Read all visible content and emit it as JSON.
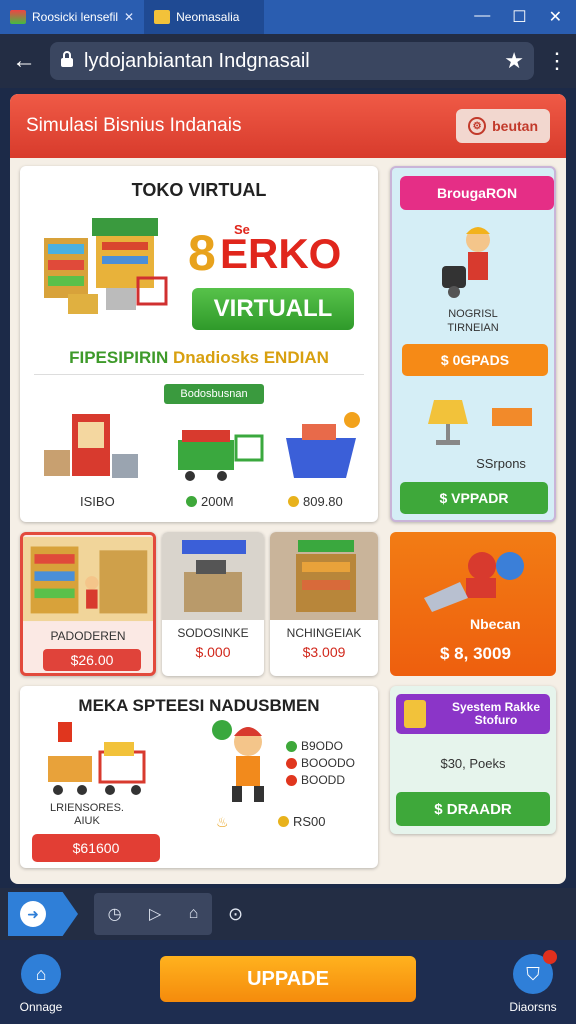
{
  "browser": {
    "tab1_title": "Roosicki lensefil",
    "tab2_title": "Neomasalia",
    "url": "lydojanbiantan Indgnasail"
  },
  "app": {
    "header_title": "Simulasi Bisnius Indanais",
    "header_button": "beutan"
  },
  "main_card": {
    "title": "TOKO VIRTUAL",
    "brand_digit": "8",
    "brand_small": "Se",
    "brand_text": "ERKO",
    "virtual_button": "VIRTUALL",
    "subtitle_green": "FIPESIPIRIN",
    "subtitle_yellow": "Dnadiosks ENDIAN",
    "tag": "Bodosbusnan",
    "products": [
      {
        "label": "ISIBO"
      },
      {
        "label": "200M"
      },
      {
        "label": "809.80"
      }
    ]
  },
  "side_card_1": {
    "header": "BrougaRON",
    "text_line1": "NOGRISL",
    "text_line2": "TIRNEIAN",
    "orange_button": "$ 0GPADS",
    "subtext": "SSrpons",
    "green_button": "$ VPPADR"
  },
  "tiles": [
    {
      "label": "PADODEREN",
      "price": "$26.00"
    },
    {
      "label": "SODOSINKE",
      "price": "$.000"
    },
    {
      "label": "NCHINGEIAK",
      "price": "$3.009"
    }
  ],
  "orange_card": {
    "name": "Nbecan",
    "price": "$ 8, 3009"
  },
  "bottom_card": {
    "title": "MEKA SPTEESI NADUSBMEN",
    "label_line1": "LRIENSORES.",
    "label_line2": "AIUK",
    "button": "$61600",
    "list": [
      "B9ODO",
      "BOOODO",
      "BOODD"
    ],
    "foot": "RS00"
  },
  "side_card_3": {
    "banner_line1": "Syestem Rakke",
    "banner_line2": "Stofuro",
    "price": "$30, Poeks",
    "button": "$ DRAADR"
  },
  "bottom_nav": {
    "left_label": "Onnage",
    "upgrade": "UPPADE",
    "right_label": "Diaorsns"
  },
  "colors": {
    "header_red": "#e04a38",
    "green": "#3ea83a",
    "orange": "#f68a16",
    "magenta": "#e52e86",
    "purple": "#8b35c8",
    "nav_blue": "#2f7fd8"
  }
}
